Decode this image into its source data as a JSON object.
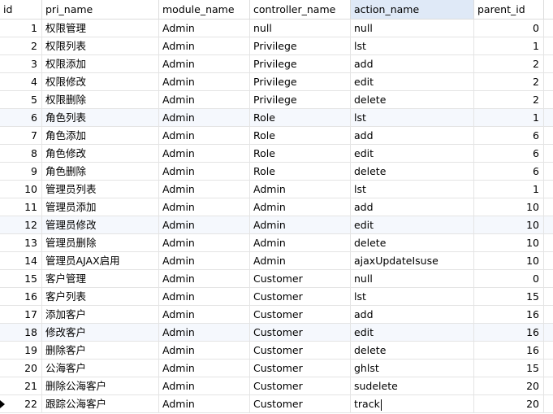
{
  "columns": [
    "id",
    "pri_name",
    "module_name",
    "controller_name",
    "action_name",
    "parent_id"
  ],
  "sorted_column": "action_name",
  "rows": [
    {
      "id": "1",
      "pri_name": "权限管理",
      "module_name": "Admin",
      "controller_name": "null",
      "action_name": "null",
      "parent_id": "0"
    },
    {
      "id": "2",
      "pri_name": "权限列表",
      "module_name": "Admin",
      "controller_name": "Privilege",
      "action_name": "lst",
      "parent_id": "1"
    },
    {
      "id": "3",
      "pri_name": "权限添加",
      "module_name": "Admin",
      "controller_name": "Privilege",
      "action_name": "add",
      "parent_id": "2"
    },
    {
      "id": "4",
      "pri_name": "权限修改",
      "module_name": "Admin",
      "controller_name": "Privilege",
      "action_name": "edit",
      "parent_id": "2"
    },
    {
      "id": "5",
      "pri_name": "权限删除",
      "module_name": "Admin",
      "controller_name": "Privilege",
      "action_name": "delete",
      "parent_id": "2"
    },
    {
      "id": "6",
      "pri_name": "角色列表",
      "module_name": "Admin",
      "controller_name": "Role",
      "action_name": "lst",
      "parent_id": "1"
    },
    {
      "id": "7",
      "pri_name": "角色添加",
      "module_name": "Admin",
      "controller_name": "Role",
      "action_name": "add",
      "parent_id": "6"
    },
    {
      "id": "8",
      "pri_name": "角色修改",
      "module_name": "Admin",
      "controller_name": "Role",
      "action_name": "edit",
      "parent_id": "6"
    },
    {
      "id": "9",
      "pri_name": "角色删除",
      "module_name": "Admin",
      "controller_name": "Role",
      "action_name": "delete",
      "parent_id": "6"
    },
    {
      "id": "10",
      "pri_name": "管理员列表",
      "module_name": "Admin",
      "controller_name": "Admin",
      "action_name": "lst",
      "parent_id": "1"
    },
    {
      "id": "11",
      "pri_name": "管理员添加",
      "module_name": "Admin",
      "controller_name": "Admin",
      "action_name": "add",
      "parent_id": "10"
    },
    {
      "id": "12",
      "pri_name": "管理员修改",
      "module_name": "Admin",
      "controller_name": "Admin",
      "action_name": "edit",
      "parent_id": "10"
    },
    {
      "id": "13",
      "pri_name": "管理员删除",
      "module_name": "Admin",
      "controller_name": "Admin",
      "action_name": "delete",
      "parent_id": "10"
    },
    {
      "id": "14",
      "pri_name": "管理员AJAX启用",
      "module_name": "Admin",
      "controller_name": "Admin",
      "action_name": "ajaxUpdateIsuse",
      "parent_id": "10"
    },
    {
      "id": "15",
      "pri_name": "客户管理",
      "module_name": "Admin",
      "controller_name": "Customer",
      "action_name": "null",
      "parent_id": "0"
    },
    {
      "id": "16",
      "pri_name": "客户列表",
      "module_name": "Admin",
      "controller_name": "Customer",
      "action_name": "lst",
      "parent_id": "15"
    },
    {
      "id": "17",
      "pri_name": "添加客户",
      "module_name": "Admin",
      "controller_name": "Customer",
      "action_name": "add",
      "parent_id": "16"
    },
    {
      "id": "18",
      "pri_name": "修改客户",
      "module_name": "Admin",
      "controller_name": "Customer",
      "action_name": "edit",
      "parent_id": "16"
    },
    {
      "id": "19",
      "pri_name": "删除客户",
      "module_name": "Admin",
      "controller_name": "Customer",
      "action_name": "delete",
      "parent_id": "16"
    },
    {
      "id": "20",
      "pri_name": "公海客户",
      "module_name": "Admin",
      "controller_name": "Customer",
      "action_name": "ghlst",
      "parent_id": "15"
    },
    {
      "id": "21",
      "pri_name": "删除公海客户",
      "module_name": "Admin",
      "controller_name": "Customer",
      "action_name": "sudelete",
      "parent_id": "20"
    },
    {
      "id": "22",
      "pri_name": "跟踪公海客户",
      "module_name": "Admin",
      "controller_name": "Customer",
      "action_name": "track",
      "parent_id": "20"
    }
  ],
  "editing_row": 21,
  "editing_column": "action_name",
  "alt_rows": [
    5,
    11,
    17
  ],
  "colors": {
    "header_sorted": "#dfe9f7",
    "row_alt": "#f5f8fd",
    "grid_line": "#e4e4e4"
  },
  "icons": {
    "row_pointer": "current-row-pointer-icon"
  }
}
